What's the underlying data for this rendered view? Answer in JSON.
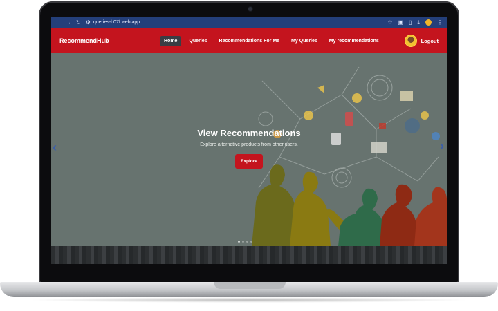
{
  "browser": {
    "url": "queries-b07f.web.app"
  },
  "nav": {
    "brand": "RecommendHub",
    "links": [
      "Home",
      "Queries",
      "Recommendations For Me",
      "My Queries",
      "My recommendations"
    ],
    "active_index": 0,
    "logout": "Logout"
  },
  "hero": {
    "title": "View Recommendations",
    "subtitle": "Explore alternative products from other users.",
    "button": "Explore",
    "slide_count": 4,
    "active_slide": 1
  },
  "colors": {
    "nav_bg": "#c4141e",
    "browser_bar": "#243f7a",
    "hero_bg": "#67736f",
    "active_tab_bg": "#3a3d44"
  }
}
